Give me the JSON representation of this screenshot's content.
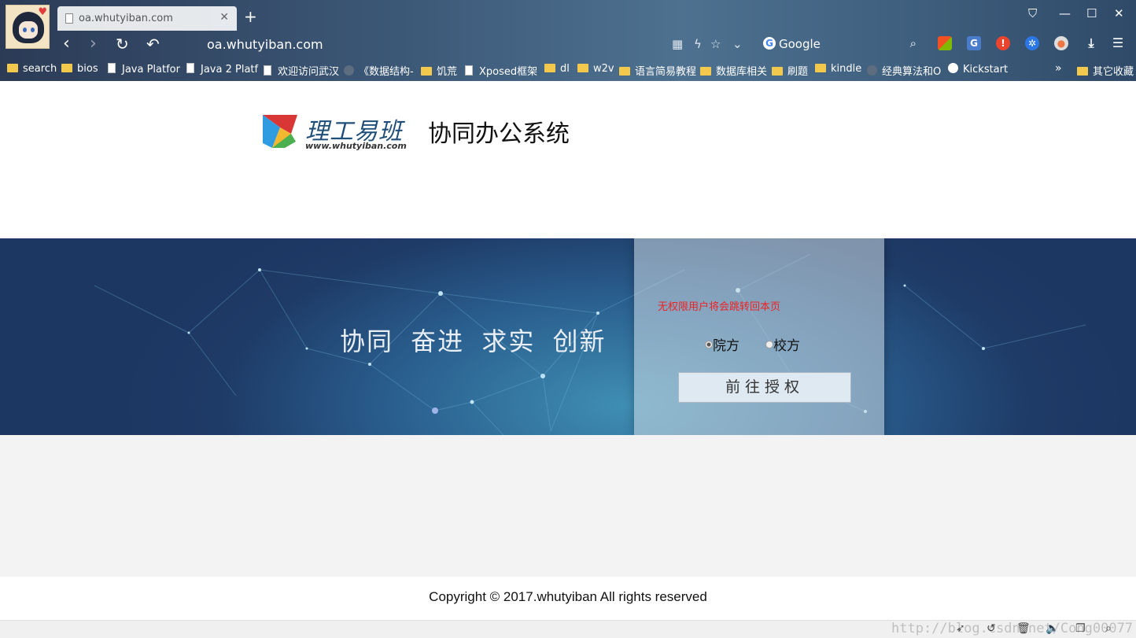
{
  "browser": {
    "tab_title": "oa.whutyiban.com",
    "new_tab": "+",
    "url": "oa.whutyiban.com",
    "search_engine": "Google",
    "window_controls": [
      "⛉",
      "—",
      "☐",
      "✕"
    ],
    "nav": {
      "back": "‹",
      "forward": "›",
      "reload": "↻",
      "undo": "↶"
    },
    "url_icons": [
      "qr-icon",
      "lightning-icon",
      "star-icon",
      "chevron-down-icon"
    ],
    "extensions": [
      "windows-icon",
      "translate-icon",
      "alert-icon",
      "blue-icon",
      "circle-icon",
      "download-icon",
      "menu-icon"
    ],
    "bookmarks": [
      {
        "label": "search",
        "icon": "folder"
      },
      {
        "label": "bios",
        "icon": "folder"
      },
      {
        "label": "Java Platfor",
        "icon": "page"
      },
      {
        "label": "Java 2 Platf",
        "icon": "page"
      },
      {
        "label": "欢迎访问武汉",
        "icon": "page"
      },
      {
        "label": "《数据结构-",
        "icon": "round"
      },
      {
        "label": "饥荒",
        "icon": "folder"
      },
      {
        "label": "Xposed框架",
        "icon": "page"
      },
      {
        "label": "dl",
        "icon": "folder"
      },
      {
        "label": "w2v",
        "icon": "folder"
      },
      {
        "label": "语言简易教程",
        "icon": "folder"
      },
      {
        "label": "数据库相关",
        "icon": "folder"
      },
      {
        "label": "刷题",
        "icon": "folder"
      },
      {
        "label": "kindle",
        "icon": "folder"
      },
      {
        "label": "经典算法和O",
        "icon": "round"
      },
      {
        "label": "Kickstart",
        "icon": "g"
      }
    ],
    "bookmarks_more": "»",
    "other_bookmarks": "其它收藏"
  },
  "header": {
    "logo_cn": "理工易班",
    "logo_url": "www.whutyiban.com",
    "system_title": "协同办公系统"
  },
  "banner": {
    "slogan": "协同 奋进 求实 创新"
  },
  "login": {
    "notice": "无权限用户将会跳转回本页",
    "options": [
      {
        "label": "院方",
        "selected": true
      },
      {
        "label": "校方",
        "selected": false
      }
    ],
    "button_label": "前往授权"
  },
  "footer": {
    "copyright": "Copyright © 2017.whutyiban All rights reserved"
  },
  "status": {
    "watermark": "http://blog.csdn.net/Cong00077"
  },
  "colors": {
    "notice_red": "#ee2222",
    "banner_dark": "#1e3a66",
    "banner_light": "#3f8eb3"
  }
}
